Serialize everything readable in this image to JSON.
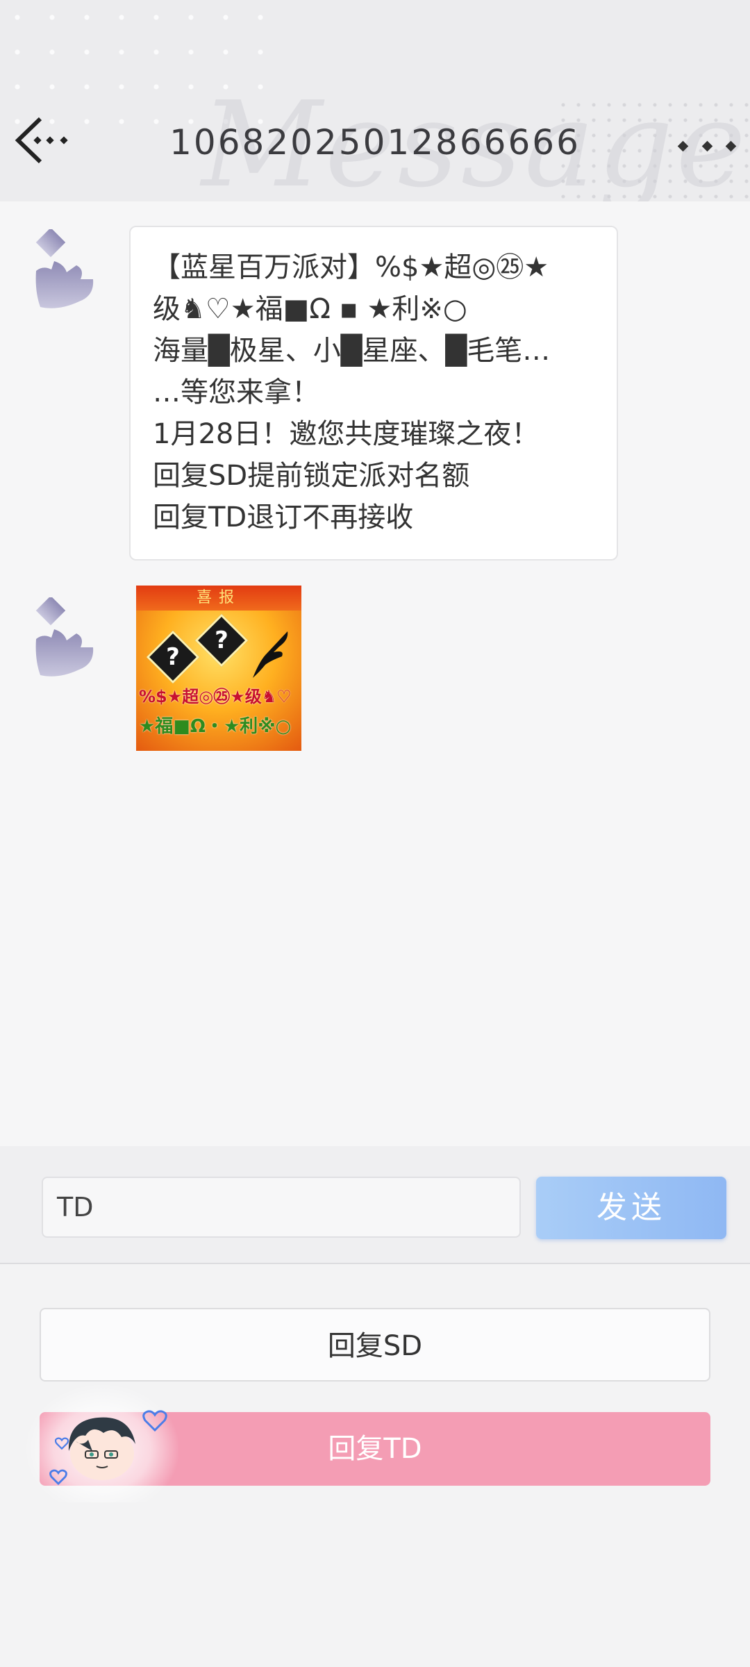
{
  "header": {
    "title": "10682025012866666",
    "watermark": "Message",
    "back_icon": "back-arrow-icon",
    "more_icon": "more-dots-icon"
  },
  "messages": [
    {
      "type": "text",
      "lines": [
        "【蓝星百万派对】%$★超◎㉕★",
        "级♞♡★福■Ω ▪ ★利※○",
        "海量█极星、小█星座、█毛笔…",
        "…等您来拿！",
        "1月28日！邀您共度璀璨之夜！",
        "回复SD提前锁定派对名额",
        "回复TD退订不再接收"
      ]
    },
    {
      "type": "image",
      "image": {
        "band": "喜报",
        "line1": "%$★超◎㉕★级♞♡",
        "line2": "★福■Ω・★利※○"
      }
    }
  ],
  "input": {
    "value": "TD",
    "send_label": "发送"
  },
  "replies": {
    "sd_label": "回复SD",
    "td_label": "回复TD"
  },
  "colors": {
    "send": "#8fb8f3",
    "reply_td": "#f49db4",
    "avatar": "#a9a6c8"
  }
}
